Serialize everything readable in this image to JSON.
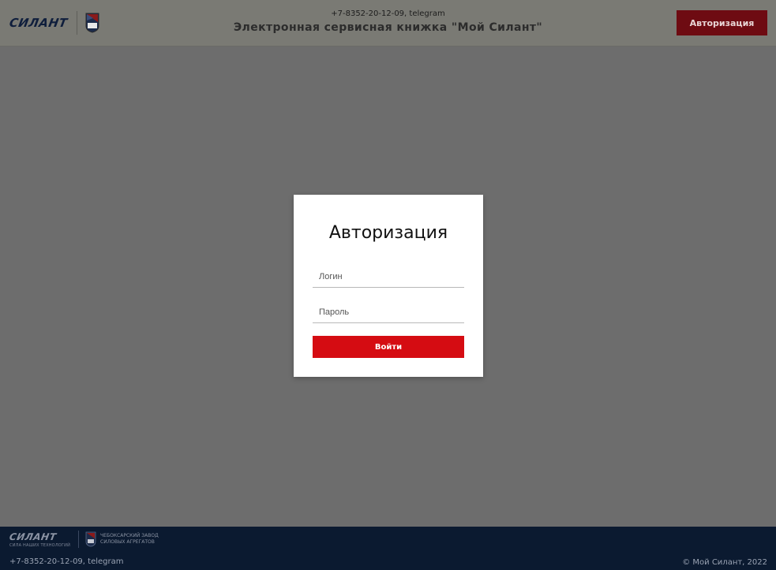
{
  "header": {
    "logo_text": "СИЛАНТ",
    "emblem_text": "ЧЗСА",
    "phone": "+7-8352-20-12-09, telegram",
    "title": "Электронная сервисная книжка \"Мой Силант\"",
    "auth_button": "Авторизация"
  },
  "modal": {
    "title": "Авторизация",
    "login_placeholder": "Логин",
    "password_placeholder": "Пароль",
    "submit_label": "Войти"
  },
  "footer": {
    "logo_text": "СИЛАНТ",
    "slogan": "СИЛА НАШИХ ТЕХНОЛОГИЙ",
    "plant_line1": "ЧЕБОКСАРСКИЙ ЗАВОД",
    "plant_line2": "СИЛОВЫХ АГРЕГАТОВ",
    "phone": "+7-8352-20-12-09, telegram",
    "copyright": "© Мой Силант, 2022"
  },
  "colors": {
    "brand_red": "#d50c12",
    "header_button": "#6e0b12",
    "footer_bg": "#0b1a30",
    "overlay": "#6d6d6d"
  },
  "icons": [
    "silant-logo",
    "chzsa-emblem"
  ]
}
